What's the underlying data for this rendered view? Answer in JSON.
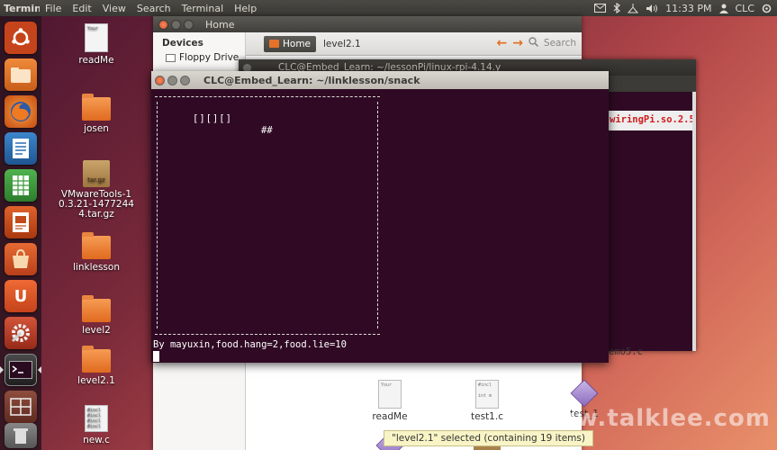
{
  "top_panel": {
    "app_name": "Terminal",
    "menu": [
      "File",
      "Edit",
      "View",
      "Search",
      "Terminal",
      "Help"
    ],
    "clock": "11:33 PM",
    "user": "CLC"
  },
  "launcher": {
    "items": [
      {
        "name": "dash-home",
        "color": "#c6441b"
      },
      {
        "name": "files",
        "color": "#e07a2b"
      },
      {
        "name": "firefox",
        "color": "#d85e16"
      },
      {
        "name": "writer",
        "color": "#2c6fb0"
      },
      {
        "name": "calc",
        "color": "#3d9a3d"
      },
      {
        "name": "impress",
        "color": "#c24a1a"
      },
      {
        "name": "software-center",
        "color": "#d85a2a"
      },
      {
        "name": "ubuntu-one",
        "color": "#d8592a"
      },
      {
        "name": "system-settings",
        "color": "#b8402a"
      },
      {
        "name": "terminal",
        "color": "#2f2f2f"
      },
      {
        "name": "workspaces",
        "color": "#8a4a3a"
      },
      {
        "name": "trash",
        "color": "#6b6b6b"
      }
    ]
  },
  "desktop": {
    "icons": [
      {
        "label": "readMe",
        "kind": "doc",
        "lines": [
          "Your"
        ]
      },
      {
        "label": "josen",
        "kind": "folder"
      },
      {
        "label": "VMwareTools-10.3.21-14772444.tar.gz",
        "kind": "archive",
        "badge": "tar.gz"
      },
      {
        "label": "linklesson",
        "kind": "folder"
      },
      {
        "label": "level2",
        "kind": "folder"
      },
      {
        "label": "level2.1",
        "kind": "folder"
      },
      {
        "label": "new.c",
        "kind": "doc",
        "lines": [
          "#incl",
          "#incl",
          "#incl",
          "#incl"
        ]
      }
    ]
  },
  "files_window": {
    "title": "Home",
    "sidebar_heading": "Devices",
    "sidebar_items": [
      "Floppy Drive"
    ],
    "breadcrumb_home": "Home",
    "breadcrumb_current": "level2.1",
    "search_label": "Search",
    "files": [
      {
        "label": "readMe",
        "kind": "doc",
        "lines": [
          "Your"
        ]
      },
      {
        "label": "test1.c",
        "kind": "doc",
        "lines": [
          "#incl",
          "",
          "int m"
        ]
      },
      {
        "label": "test_1",
        "kind": "exec"
      }
    ],
    "status": "\"level2.1\" selected (containing 19 items)"
  },
  "terminal_back": {
    "title": "CLC@Embed_Learn: ~/lessonPi/linux-rpi-4.14.y",
    "highlight_text": "wiringPi.so.2.5",
    "bottom_text": "emo5.c"
  },
  "terminal_front": {
    "title": "CLC@Embed_Learn: ~/linklesson/snack",
    "snake": "[][][]",
    "food": "##",
    "status_line": "By mayuxin,food.hang=2,food.lie=10"
  },
  "watermark": "www.talklee.com"
}
